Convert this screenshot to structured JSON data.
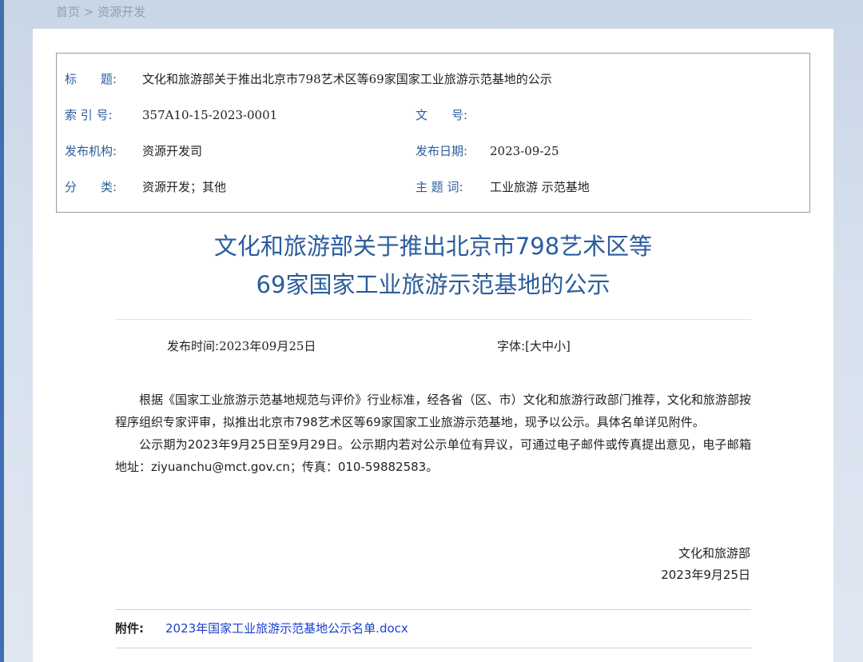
{
  "breadcrumb": {
    "home": "首页",
    "separator": " > ",
    "current": "资源开发"
  },
  "meta": {
    "title_label": "标　　题:",
    "title_value": "文化和旅游部关于推出北京市798艺术区等69家国家工业旅游示范基地的公示",
    "index_label": "索 引 号:",
    "index_value": "357A10-15-2023-0001",
    "docno_label": "文　　号:",
    "docno_value": "",
    "org_label": "发布机构:",
    "org_value": "资源开发司",
    "date_label": "发布日期:",
    "date_value": "2023-09-25",
    "category_label": "分　　类:",
    "category_value": "资源开发；其他",
    "keyword_label": "主 题 词:",
    "keyword_value": "工业旅游 示范基地"
  },
  "article": {
    "title_line1": "文化和旅游部关于推出北京市798艺术区等",
    "title_line2": "69家国家工业旅游示范基地的公示",
    "pub_time_label": "发布时间:",
    "pub_time_value": "2023年09月25日",
    "font_label": "字体:",
    "font_bracket_open": "[",
    "font_large": "大",
    "font_medium": "中",
    "font_small": "小",
    "font_bracket_close": "]",
    "paragraph1": "根据《国家工业旅游示范基地规范与评价》行业标准，经各省（区、市）文化和旅游行政部门推荐，文化和旅游部按程序组织专家评审，拟推出北京市798艺术区等69家国家工业旅游示范基地，现予以公示。具体名单详见附件。",
    "paragraph2": "公示期为2023年9月25日至9月29日。公示期内若对公示单位有异议，可通过电子邮件或传真提出意见，电子邮箱地址：ziyuanchu@mct.gov.cn；传真：010-59882583。",
    "signer": "文化和旅游部",
    "sign_date": "2023年9月25日",
    "attachment_label": "附件:",
    "attachment_link": "2023年国家工业旅游示范基地公示名单.docx"
  },
  "colors": {
    "accent": "#2b5d9c",
    "link": "#1a3fd1",
    "strip": "#3f6fb0"
  }
}
